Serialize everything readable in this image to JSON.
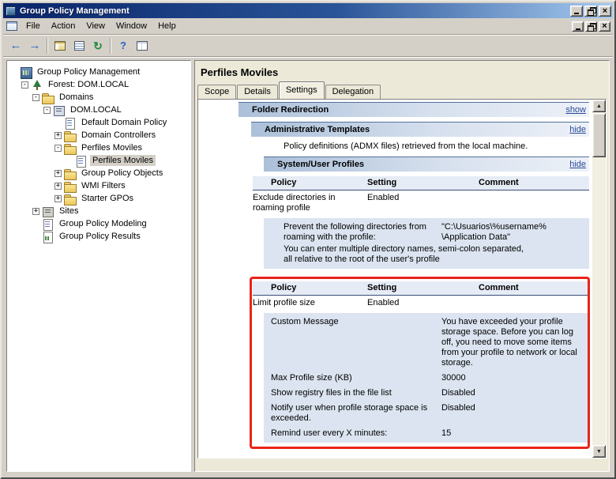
{
  "window": {
    "title": "Group Policy Management",
    "controls": [
      "minimize",
      "restore",
      "close"
    ]
  },
  "menubar": {
    "items": [
      "File",
      "Action",
      "View",
      "Window",
      "Help"
    ],
    "controls": [
      "minimize",
      "restore",
      "close"
    ]
  },
  "toolbar": {
    "items": [
      {
        "name": "back-button",
        "icon": "back-arrow-icon"
      },
      {
        "name": "forward-button",
        "icon": "forward-arrow-icon"
      },
      {
        "type": "sep"
      },
      {
        "name": "show-console-tree-button",
        "icon": "console-tree-icon"
      },
      {
        "name": "export-list-button",
        "icon": "export-list-icon"
      },
      {
        "name": "refresh-button",
        "icon": "refresh-icon"
      },
      {
        "type": "sep"
      },
      {
        "name": "help-button",
        "icon": "help-icon"
      },
      {
        "name": "columns-button",
        "icon": "columns-icon"
      }
    ]
  },
  "tree": {
    "items": [
      {
        "label": "Group Policy Management",
        "level": 0,
        "expander": null,
        "icon": "gpmc-root-icon",
        "selected": false
      },
      {
        "label": "Forest: DOM.LOCAL",
        "level": 1,
        "expander": "minus",
        "icon": "forest-icon",
        "selected": false
      },
      {
        "label": "Domains",
        "level": 2,
        "expander": "minus",
        "icon": "domains-icon",
        "selected": false
      },
      {
        "label": "DOM.LOCAL",
        "level": 3,
        "expander": "minus",
        "icon": "domain-icon",
        "selected": false
      },
      {
        "label": "Default Domain Policy",
        "level": 4,
        "expander": null,
        "icon": "gpo-icon",
        "selected": false
      },
      {
        "label": "Domain Controllers",
        "level": 4,
        "expander": "plus",
        "icon": "ou-icon",
        "selected": false
      },
      {
        "label": "Perfiles Moviles",
        "level": 4,
        "expander": "minus",
        "icon": "ou-icon",
        "selected": false
      },
      {
        "label": "Perfiles Moviles",
        "level": 5,
        "expander": null,
        "icon": "gpo-icon",
        "selected": true
      },
      {
        "label": "Group Policy Objects",
        "level": 4,
        "expander": "plus",
        "icon": "folder-icon",
        "selected": false
      },
      {
        "label": "WMI Filters",
        "level": 4,
        "expander": "plus",
        "icon": "folder-icon",
        "selected": false
      },
      {
        "label": "Starter GPOs",
        "level": 4,
        "expander": "plus",
        "icon": "folder-icon",
        "selected": false
      },
      {
        "label": "Sites",
        "level": 2,
        "expander": "plus",
        "icon": "sites-icon",
        "selected": false
      },
      {
        "label": "Group Policy Modeling",
        "level": 2,
        "expander": null,
        "icon": "modeling-icon",
        "selected": false
      },
      {
        "label": "Group Policy Results",
        "level": 2,
        "expander": null,
        "icon": "results-icon",
        "selected": false
      }
    ]
  },
  "main": {
    "page_title": "Perfiles Moviles",
    "tabs": [
      {
        "label": "Scope",
        "active": false
      },
      {
        "label": "Details",
        "active": false
      },
      {
        "label": "Settings",
        "active": true
      },
      {
        "label": "Delegation",
        "active": false
      }
    ],
    "report": {
      "folder_redirection": {
        "title": "Folder Redirection",
        "link": "show"
      },
      "admin_templates": {
        "title": "Administrative Templates",
        "link": "hide",
        "description": "Policy definitions (ADMX files) retrieved from the local machine.",
        "system_user_profiles": {
          "title": "System/User Profiles",
          "link": "hide",
          "table1": {
            "headers": [
              "Policy",
              "Setting",
              "Comment"
            ],
            "row": {
              "policy": "Exclude directories in roaming profile",
              "setting": "Enabled",
              "comment": ""
            },
            "details": [
              {
                "label": "Prevent the following directories from roaming with the profile:",
                "value": "\"C:\\Usuarios\\%username%\n\\Application Data\""
              }
            ],
            "note": "You can enter multiple directory names, semi-colon separated,\nall relative to the root of the user's profile"
          },
          "table2": {
            "headers": [
              "Policy",
              "Setting",
              "Comment"
            ],
            "row": {
              "policy": "Limit profile size",
              "setting": "Enabled",
              "comment": ""
            },
            "details": [
              {
                "label": "Custom Message",
                "value": "You have exceeded your profile storage space. Before you can log off, you need to move some items from your profile to network or local storage."
              },
              {
                "label": "Max Profile size (KB)",
                "value": "30000"
              },
              {
                "label": "Show registry files in the file list",
                "value": "Disabled"
              },
              {
                "label": "Notify user when profile storage space is exceeded.",
                "value": "Disabled"
              },
              {
                "label": "Remind user every X minutes:",
                "value": "15"
              }
            ]
          }
        }
      }
    }
  },
  "annotation": {
    "shape": "rectangle",
    "color": "#EA2418",
    "target": "limit-profile-size-table"
  }
}
